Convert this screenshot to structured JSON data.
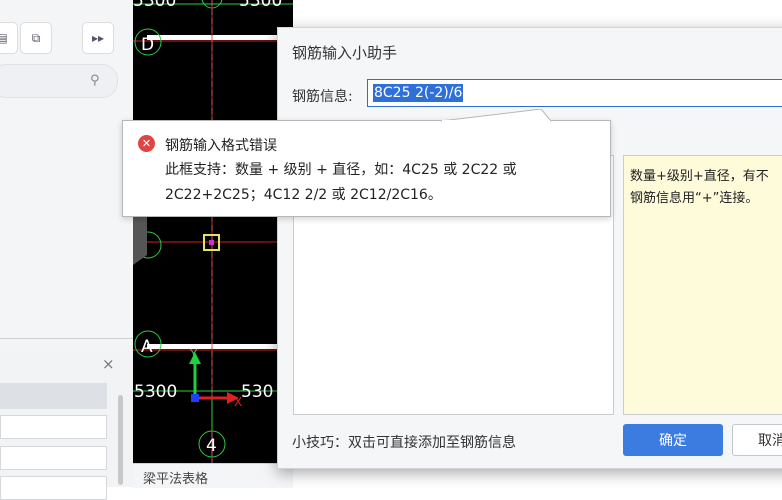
{
  "left_panel": {
    "icons": [
      "layer-icon",
      "copy-icon",
      "forward-icon"
    ],
    "lower_close": "×"
  },
  "cad": {
    "top_numbers": [
      "5300",
      "5300"
    ],
    "axis_d": "D",
    "axis_a": "A",
    "axis_4": "4",
    "dim_left": "5300",
    "dim_right": "530",
    "axis_y": "Y",
    "axis_x": "X"
  },
  "dialog": {
    "title": "钢筋输入小助手",
    "info_label": "钢筋信息:",
    "info_value": "8C25 2(-2)/6",
    "help_line1": "数量+级别+直径，有不",
    "help_line2": "钢筋信息用“+”连接。",
    "tip": "小技巧：双击可直接添加至钢筋信息",
    "ok": "确定",
    "cancel": "取消"
  },
  "bottom": {
    "label": "梁平法表格"
  },
  "error_tooltip": {
    "title": "钢筋输入格式错误",
    "line1": "此框支持：数量 + 级别 + 直径，如：4C25 或 2C22 或",
    "line2": "2C22+2C25；4C12 2/2 或 2C12/2C16。"
  },
  "colors": {
    "accent": "#3c7be0",
    "error": "#e04545",
    "help_bg": "#fdfbd9"
  }
}
